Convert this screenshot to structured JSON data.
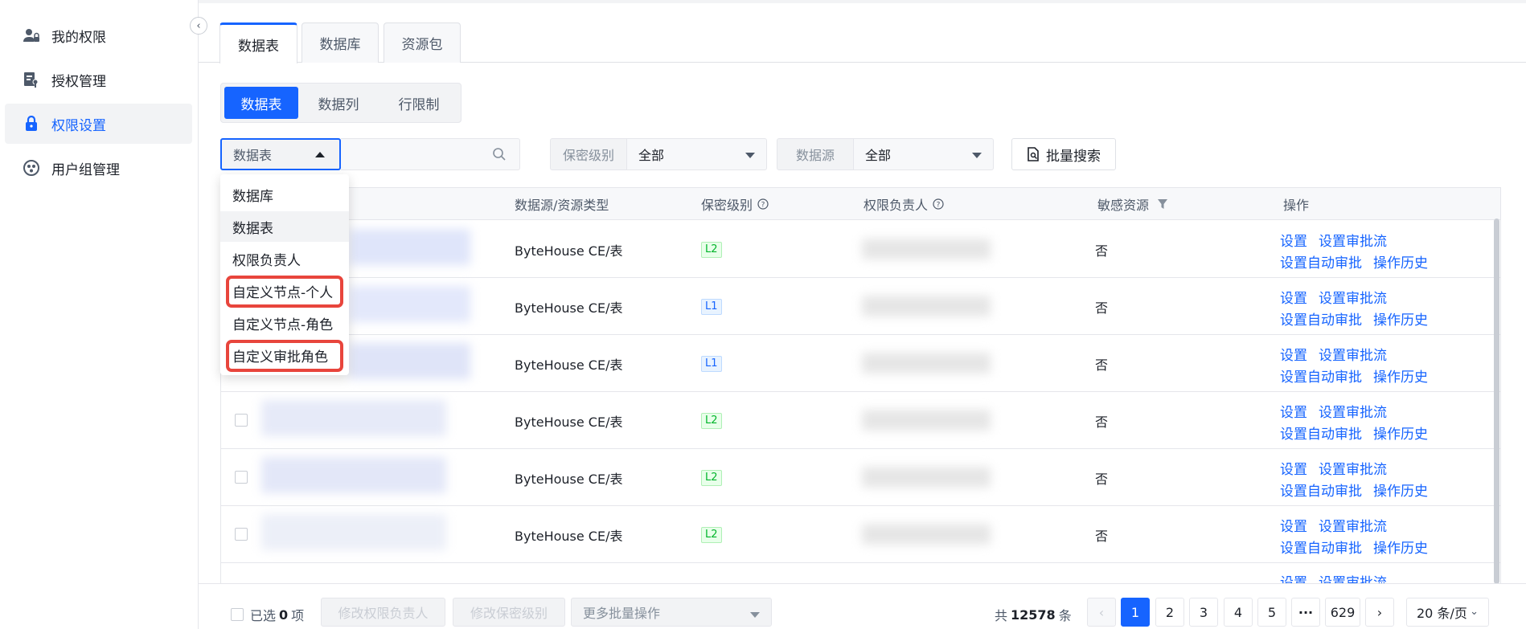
{
  "sidebar": {
    "items": [
      {
        "label": "我的权限",
        "icon": "user-lock-icon",
        "active": false
      },
      {
        "label": "授权管理",
        "icon": "doc-key-icon",
        "active": false
      },
      {
        "label": "权限设置",
        "icon": "lock-icon",
        "active": true
      },
      {
        "label": "用户组管理",
        "icon": "group-icon",
        "active": false
      }
    ]
  },
  "tabs": [
    "数据表",
    "数据库",
    "资源包"
  ],
  "segments": [
    "数据表",
    "数据列",
    "行限制"
  ],
  "search": {
    "type_value": "数据表",
    "placeholder": ""
  },
  "filters": {
    "security_label": "保密级别",
    "security_value": "全部",
    "source_label": "数据源",
    "source_value": "全部",
    "batch_search": "批量搜索"
  },
  "dropdown": {
    "options": [
      "数据库",
      "数据表",
      "权限负责人",
      "自定义节点-个人",
      "自定义节点-角色",
      "自定义审批角色"
    ],
    "selected_index": 1,
    "highlighted_indices": [
      3,
      5
    ]
  },
  "table": {
    "columns": [
      "数据源/资源类型",
      "保密级别",
      "权限负责人",
      "敏感资源",
      "操作"
    ],
    "rows": [
      {
        "source": "ByteHouse CE/表",
        "level": "L2",
        "sensitive": "否"
      },
      {
        "source": "ByteHouse CE/表",
        "level": "L1",
        "sensitive": "否"
      },
      {
        "source": "ByteHouse CE/表",
        "level": "L1",
        "sensitive": "否"
      },
      {
        "source": "ByteHouse CE/表",
        "level": "L2",
        "sensitive": "否"
      },
      {
        "source": "ByteHouse CE/表",
        "level": "L2",
        "sensitive": "否"
      },
      {
        "source": "ByteHouse CE/表",
        "level": "L2",
        "sensitive": "否"
      }
    ],
    "actions": {
      "set": "设置",
      "approval_flow": "设置审批流",
      "auto_approve": "设置自动审批",
      "history": "操作历史"
    }
  },
  "footer": {
    "selected_prefix": "已选",
    "selected_count": "0",
    "selected_suffix": "项",
    "btn_owner": "修改权限负责人",
    "btn_level": "修改保密级别",
    "more_ops": "更多批量操作",
    "total_prefix": "共",
    "total": "12578",
    "total_suffix": "条",
    "pages": [
      "1",
      "2",
      "3",
      "4",
      "5",
      "629"
    ],
    "ellipsis": "···",
    "page_size": "20 条/页"
  },
  "colors": {
    "primary": "#1664ff",
    "highlight": "#e8453c"
  }
}
